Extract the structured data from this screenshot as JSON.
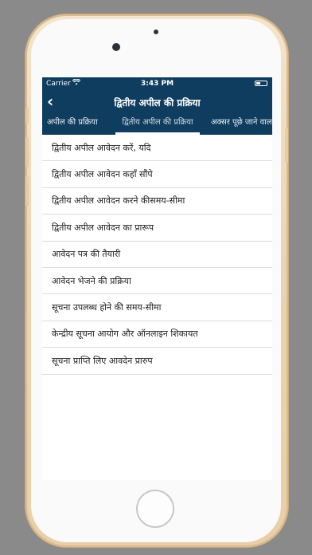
{
  "status": {
    "carrier": "Carrier",
    "time": "3:43 PM"
  },
  "nav": {
    "title": "द्वितीय अपील की प्रक्रिया",
    "back_icon": "‹"
  },
  "tabs": [
    {
      "label": "अपील की प्रक्रिया"
    },
    {
      "label": "द्वितीय अपील की प्रक्रिया"
    },
    {
      "label": "अक्सर पूछे जाने वाल"
    }
  ],
  "list": [
    "द्वितीय अपील आवेदन करें, यदि",
    "द्वितीय अपील आवेदन कहाँ सौंपे",
    "द्वितीय अपील आवेदन करने कीसमय-सीमा",
    "द्वितीय अपील आवेदन का प्रारूप",
    "आवेदन पत्र की तैयारी",
    "आवेदन भेजने की प्रक्रिया",
    "सूचना उपलब्ध होने की समय-सीमा",
    "केन्द्रीय सूचना आयोग और ऑनलाइन शिकायत",
    "सूचना प्राप्ति लिए आवदेन प्रारुप"
  ],
  "colors": {
    "nav": "#0f3d5f",
    "phone": "#ead3b0"
  }
}
